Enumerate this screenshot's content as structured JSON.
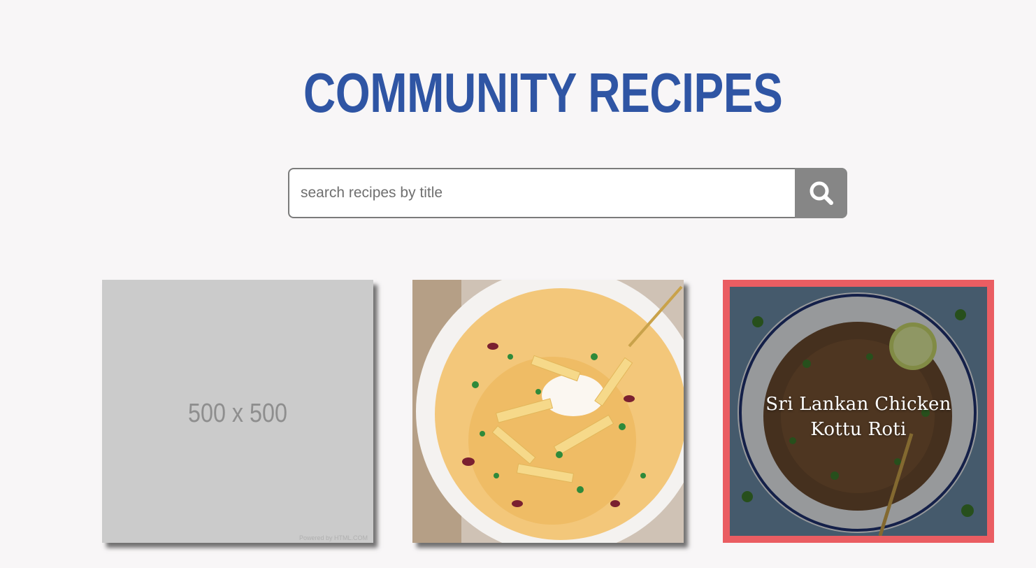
{
  "header": {
    "title": "COMMUNITY RECIPES"
  },
  "search": {
    "placeholder": "search recipes by title",
    "icon": "search-icon"
  },
  "recipes": [
    {
      "image": "placeholder-image",
      "placeholder_text": "500 x 500",
      "credit": "Powered by HTML.COM"
    },
    {
      "image": "tortilla-soup-photo"
    },
    {
      "image": "kottu-roti-photo",
      "title": "Sri Lankan Chicken Kottu Roti",
      "highlighted": true
    }
  ],
  "colors": {
    "title": "#2f55a4",
    "search_button": "#868686",
    "highlight_border": "#ea5d62",
    "background": "#f8f6f7"
  }
}
